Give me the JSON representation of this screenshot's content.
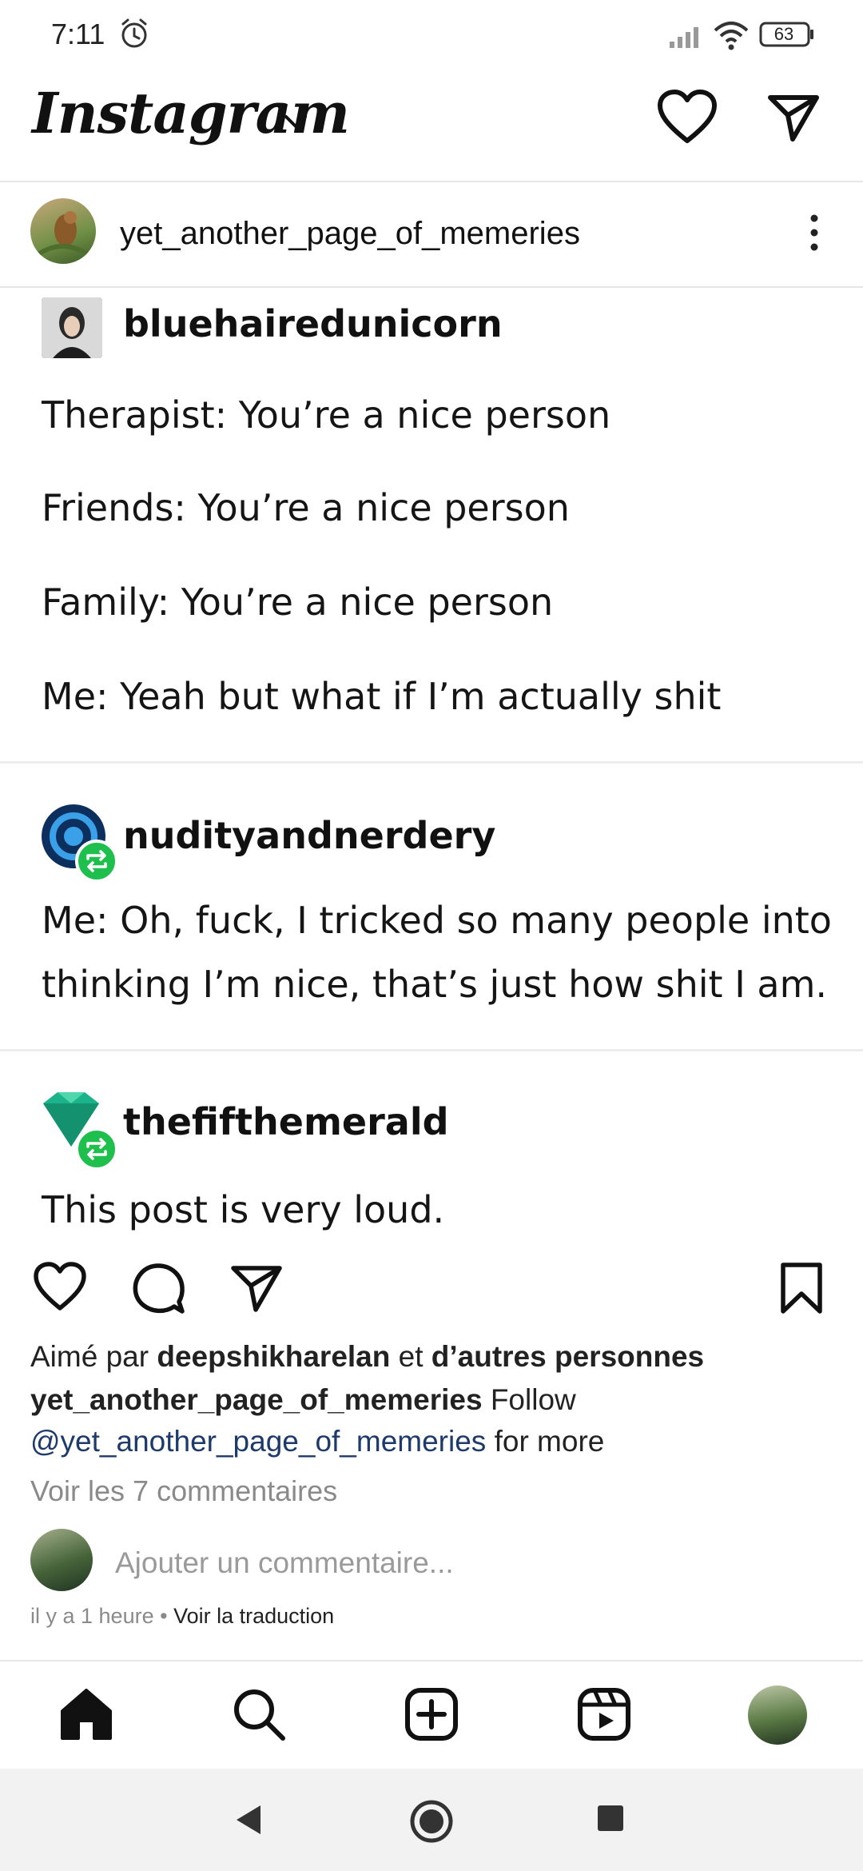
{
  "status_bar": {
    "time": "7:11",
    "battery": "63",
    "icons": [
      "alarm-icon",
      "signal-icon",
      "wifi-icon",
      "battery-icon"
    ]
  },
  "header": {
    "logo": "Instagram",
    "icons": [
      "chevron-down-icon",
      "heart-icon",
      "send-icon"
    ]
  },
  "post": {
    "username": "yet_another_page_of_memeries",
    "tumblr": {
      "blocks": [
        {
          "username": "bluehairedunicorn",
          "lines": [
            "Therapist: You’re a nice person",
            "Friends: You’re a nice person",
            "Family: You’re a nice person",
            "Me: Yeah but what if I’m actually shit"
          ]
        },
        {
          "username": "nudityandnerdery",
          "lines": [
            "Me: Oh, fuck, I tricked so many people into",
            "thinking I’m nice, that’s just how shit I am."
          ]
        },
        {
          "username": "thefifthemerald",
          "lines": [
            "This post is very loud."
          ]
        }
      ]
    },
    "likes": {
      "prefix": "Aimé par ",
      "user": "deepshikharelan",
      "middle": " et ",
      "others": "d’autres personnes"
    },
    "caption": {
      "username": "yet_another_page_of_memeries",
      "text1": " Follow",
      "mention": "@yet_another_page_of_memeries",
      "text2": " for more"
    },
    "view_comments": "Voir les 7 commentaires",
    "comment_placeholder": "Ajouter un commentaire...",
    "time_ago": "il y a 1 heure",
    "dot": " • ",
    "translate": "Voir la traduction"
  },
  "bottom_nav": [
    "home-icon",
    "search-icon",
    "create-icon",
    "reels-icon",
    "profile-avatar"
  ],
  "colors": {
    "reblog_green": "#1fbf4e",
    "mention_blue": "#1e3a6a",
    "emerald": "#1bb38a"
  }
}
